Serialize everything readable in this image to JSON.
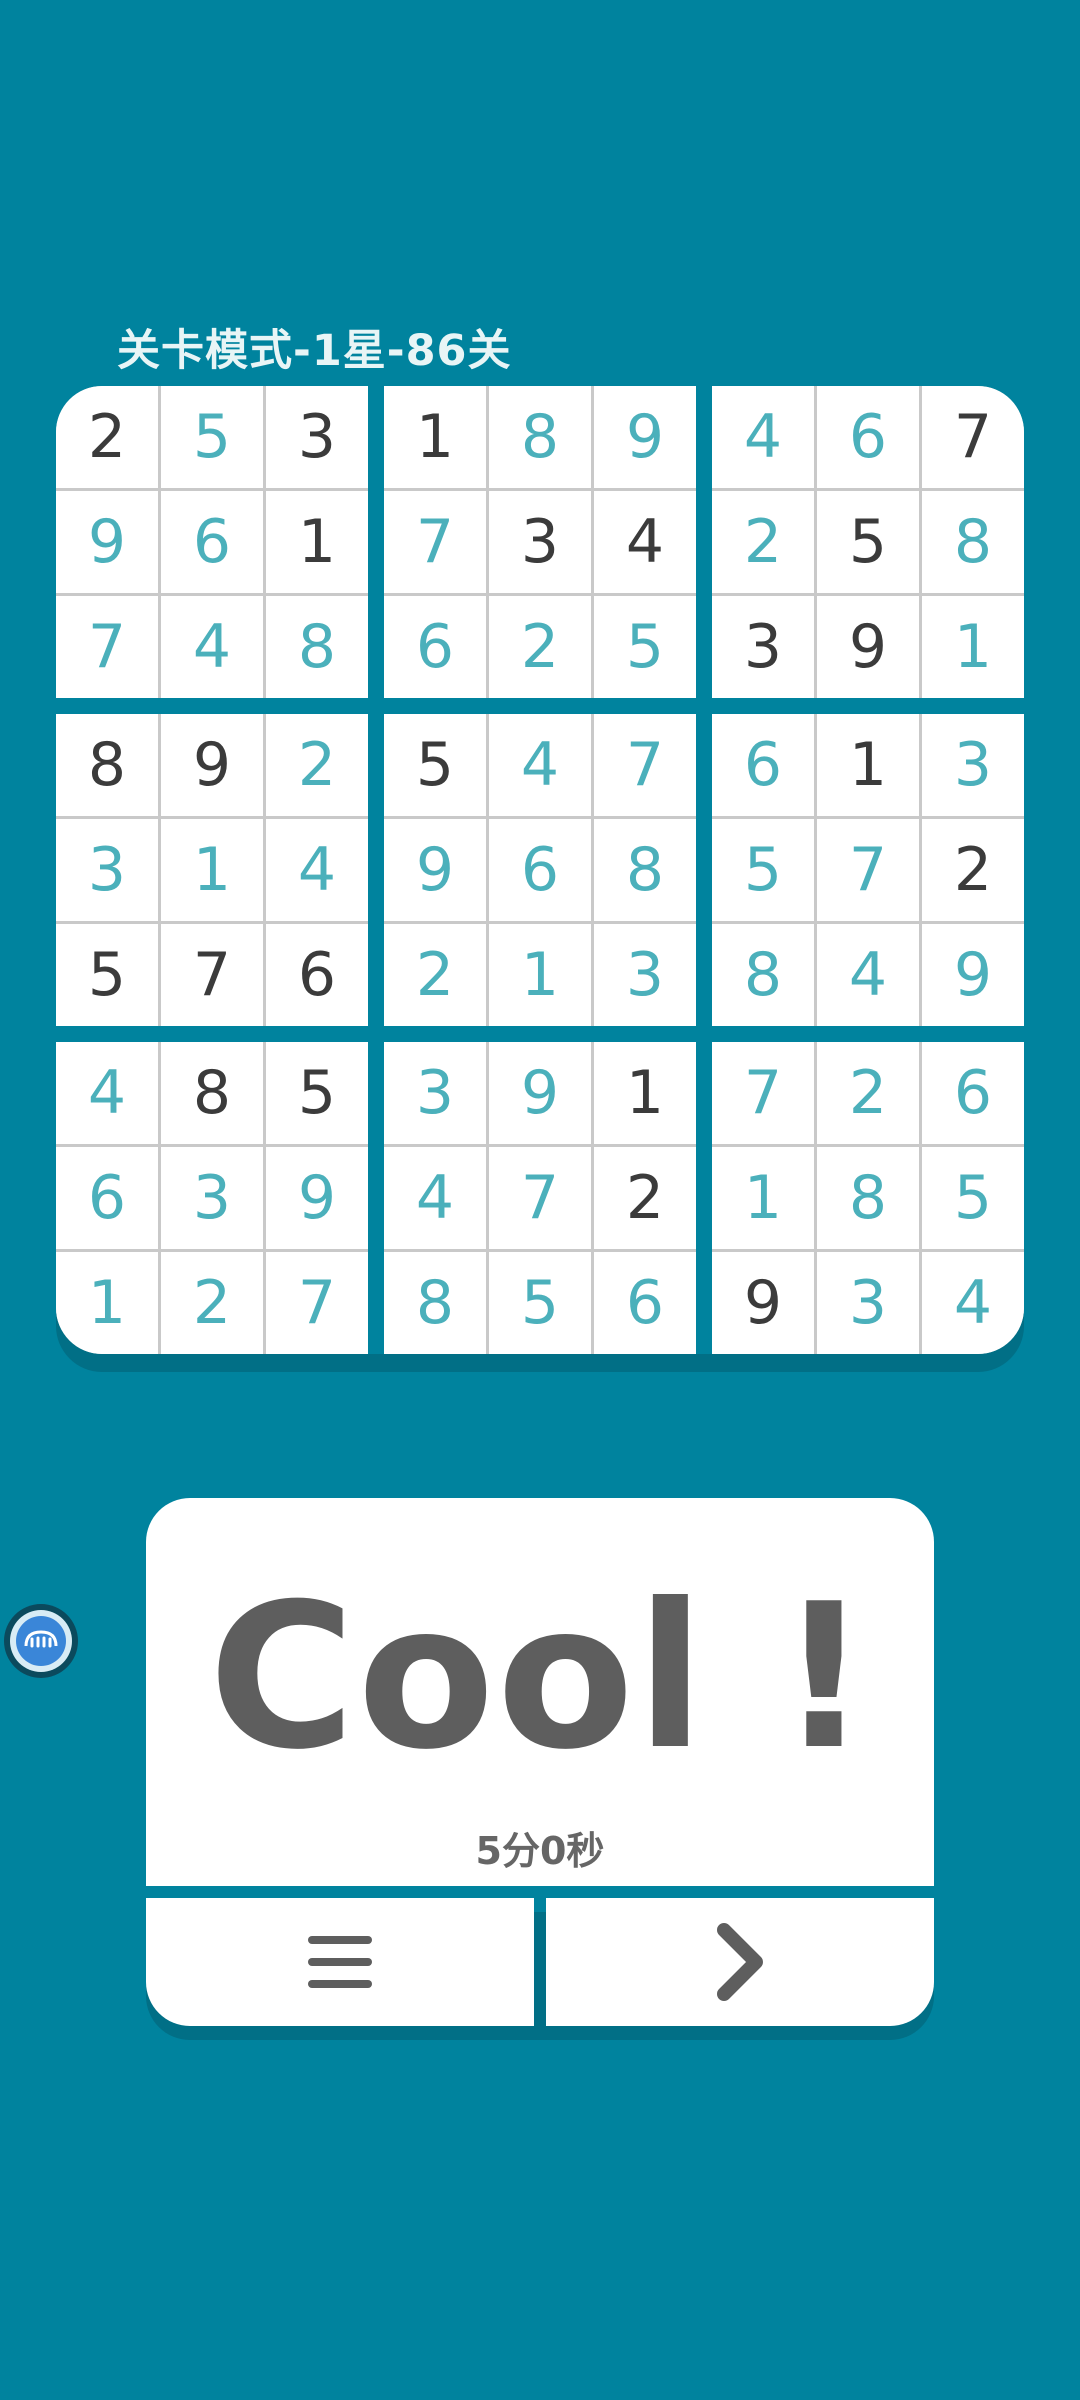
{
  "level": {
    "title": "关卡模式-1星-86关"
  },
  "board": {
    "rows": [
      [
        "2",
        "5",
        "3",
        "1",
        "8",
        "9",
        "4",
        "6",
        "7"
      ],
      [
        "9",
        "6",
        "1",
        "7",
        "3",
        "4",
        "2",
        "5",
        "8"
      ],
      [
        "7",
        "4",
        "8",
        "6",
        "2",
        "5",
        "3",
        "9",
        "1"
      ],
      [
        "8",
        "9",
        "2",
        "5",
        "4",
        "7",
        "6",
        "1",
        "3"
      ],
      [
        "3",
        "1",
        "4",
        "9",
        "6",
        "8",
        "5",
        "7",
        "2"
      ],
      [
        "5",
        "7",
        "6",
        "2",
        "1",
        "3",
        "8",
        "4",
        "9"
      ],
      [
        "4",
        "8",
        "5",
        "3",
        "9",
        "1",
        "7",
        "2",
        "6"
      ],
      [
        "6",
        "3",
        "9",
        "4",
        "7",
        "2",
        "1",
        "8",
        "5"
      ],
      [
        "1",
        "2",
        "7",
        "8",
        "5",
        "6",
        "9",
        "3",
        "4"
      ]
    ],
    "given": [
      [
        true,
        false,
        true,
        true,
        false,
        false,
        false,
        false,
        true
      ],
      [
        false,
        false,
        true,
        false,
        true,
        true,
        false,
        true,
        false
      ],
      [
        false,
        false,
        false,
        false,
        false,
        false,
        true,
        true,
        false
      ],
      [
        true,
        true,
        false,
        true,
        false,
        false,
        false,
        true,
        false
      ],
      [
        false,
        false,
        false,
        false,
        false,
        false,
        false,
        false,
        true
      ],
      [
        true,
        true,
        true,
        false,
        false,
        false,
        false,
        false,
        false
      ],
      [
        false,
        true,
        true,
        false,
        false,
        true,
        false,
        false,
        false
      ],
      [
        false,
        false,
        false,
        false,
        false,
        true,
        false,
        false,
        false
      ],
      [
        false,
        false,
        false,
        false,
        false,
        false,
        true,
        false,
        false
      ]
    ]
  },
  "result": {
    "message": "Cool !",
    "time": "5分0秒"
  },
  "buttons": {
    "menu_icon": "menu-icon",
    "next_icon": "chevron-right-icon"
  },
  "colors": {
    "background": "#00839e",
    "given_digit": "#3b3b3b",
    "filled_digit": "#4bb0bb",
    "icon": "#5e5e5e"
  }
}
